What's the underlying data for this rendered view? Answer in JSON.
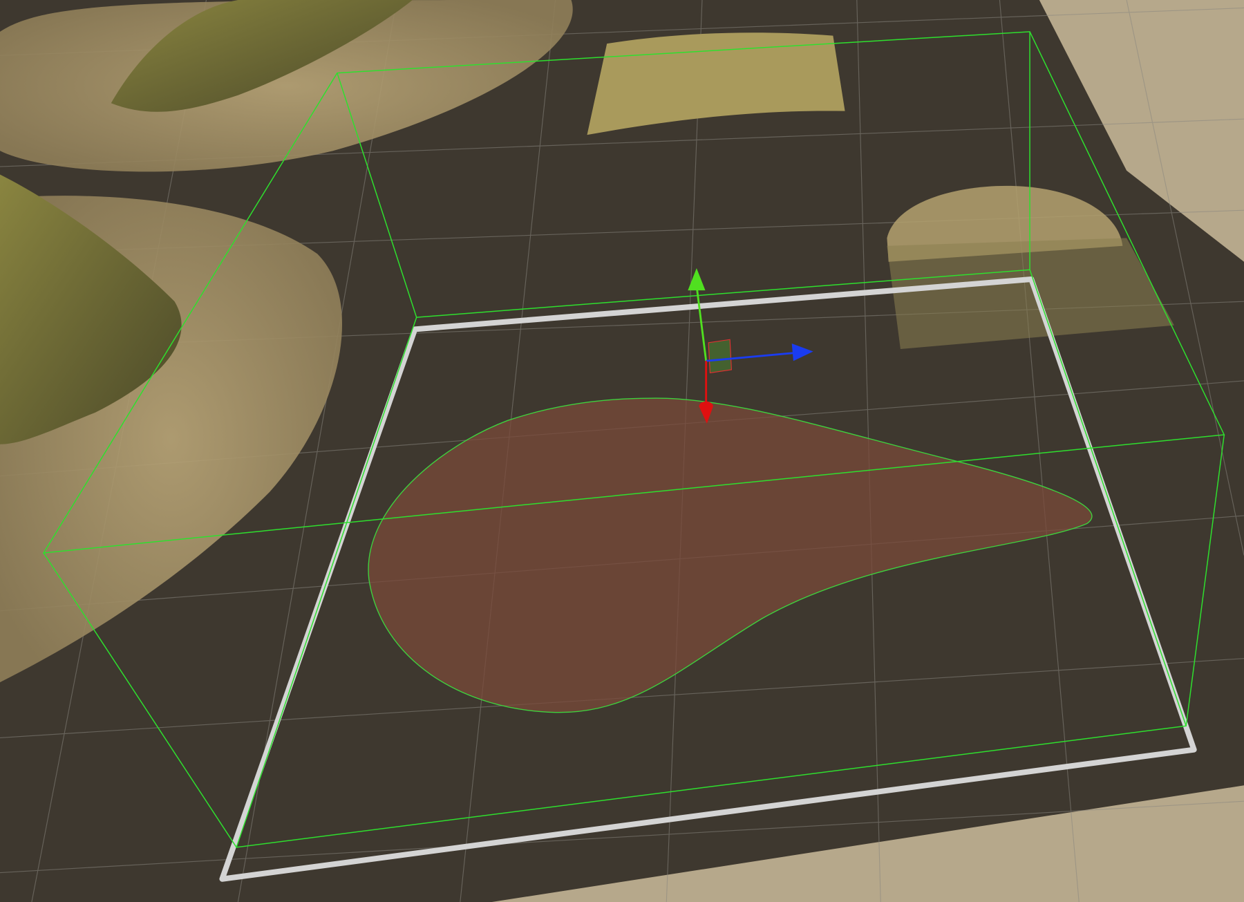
{
  "scene_view": {
    "colors": {
      "background_ground": "#b6a88b",
      "terrain_plane": "#3e382f",
      "sand": "#a8956a",
      "grass": "#7f7a3c",
      "grid_line": "#8a8780",
      "bounds_box": "#2ee02e",
      "selection_outline": "#d8d8d8",
      "area_fill": "#7a4a3a",
      "gizmo_x": "#e01010",
      "gizmo_y": "#50e020",
      "gizmo_z": "#1a3cf0"
    },
    "gizmo": {
      "icons": [
        "move-gizmo-y-arrow-icon",
        "move-gizmo-z-arrow-icon",
        "move-gizmo-x-arrow-icon",
        "plane-handle-icon"
      ]
    }
  }
}
